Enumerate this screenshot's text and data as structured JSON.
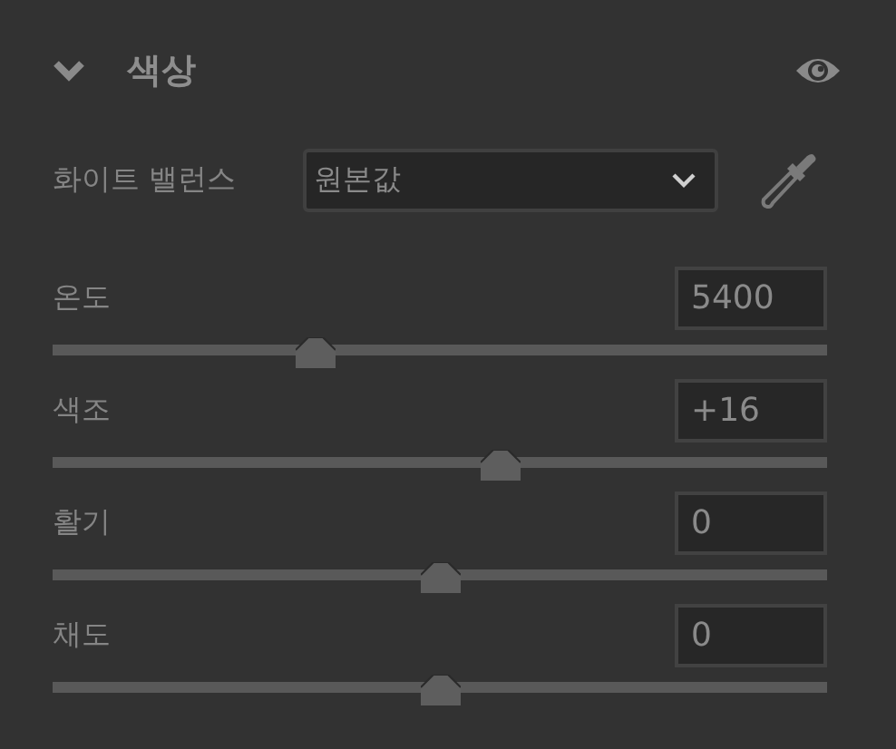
{
  "panel": {
    "title": "색상",
    "expanded": true
  },
  "white_balance": {
    "label": "화이트 밸런스",
    "value": "원본값"
  },
  "sliders": [
    {
      "label": "온도",
      "value": "5400",
      "level": 0.34
    },
    {
      "label": "색조",
      "value": "+16",
      "level": 0.578
    },
    {
      "label": "활기",
      "value": "0",
      "level": 0.5
    },
    {
      "label": "채도",
      "value": "0",
      "level": 0.5
    }
  ]
}
